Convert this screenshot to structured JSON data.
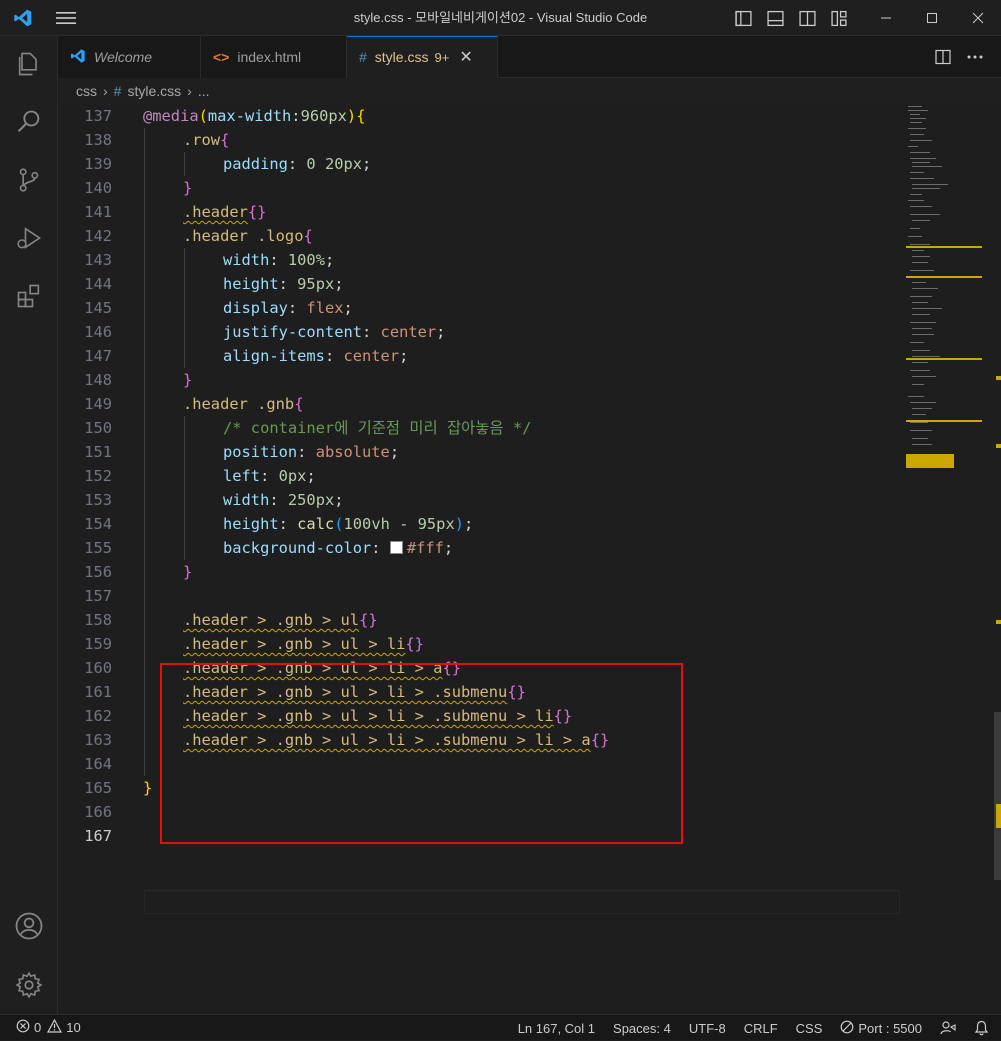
{
  "window": {
    "title": "style.css - 모바일네비게이션02 - Visual Studio Code"
  },
  "icons": {
    "app": "vscode-icon",
    "menu": "hamburger-menu-icon"
  },
  "tabs": [
    {
      "label": "Welcome",
      "icon": "vscode-icon"
    },
    {
      "label": "index.html",
      "icon": "html-icon"
    },
    {
      "label": "style.css",
      "badge": "9+",
      "icon": "hash-icon",
      "active": true
    }
  ],
  "breadcrumb": {
    "folder": "css",
    "file": "style.css",
    "more": "..."
  },
  "editor": {
    "lines": [
      {
        "n": "137"
      },
      {
        "n": "138"
      },
      {
        "n": "139"
      },
      {
        "n": "140"
      },
      {
        "n": "141"
      },
      {
        "n": "142"
      },
      {
        "n": "143"
      },
      {
        "n": "144"
      },
      {
        "n": "145"
      },
      {
        "n": "146"
      },
      {
        "n": "147"
      },
      {
        "n": "148"
      },
      {
        "n": "149"
      },
      {
        "n": "150"
      },
      {
        "n": "151"
      },
      {
        "n": "152"
      },
      {
        "n": "153"
      },
      {
        "n": "154"
      },
      {
        "n": "155"
      },
      {
        "n": "156"
      },
      {
        "n": "157"
      },
      {
        "n": "158"
      },
      {
        "n": "159"
      },
      {
        "n": "160"
      },
      {
        "n": "161"
      },
      {
        "n": "162"
      },
      {
        "n": "163"
      },
      {
        "n": "164"
      },
      {
        "n": "165"
      },
      {
        "n": "166"
      },
      {
        "n": "167"
      }
    ],
    "code": {
      "l137_a": "@media",
      "l137_b": "(",
      "l137_c": "max-width",
      "l137_d": ":",
      "l137_e": "960px",
      "l137_f": ")",
      "l137_g": "{",
      "l138_a": ".row",
      "l138_b": "{",
      "l139_a": "padding",
      "l139_b": ": ",
      "l139_c": "0 20px",
      "l139_d": ";",
      "l140_a": "}",
      "l141_a": ".header",
      "l141_b": "{}",
      "l142_a": ".header .logo",
      "l142_b": "{",
      "l143_a": "width",
      "l143_b": ": ",
      "l143_c": "100%",
      "l143_d": ";",
      "l144_a": "height",
      "l144_b": ": ",
      "l144_c": "95px",
      "l144_d": ";",
      "l145_a": "display",
      "l145_b": ": ",
      "l145_c": "flex",
      "l145_d": ";",
      "l146_a": "justify-content",
      "l146_b": ": ",
      "l146_c": "center",
      "l146_d": ";",
      "l147_a": "align-items",
      "l147_b": ": ",
      "l147_c": "center",
      "l147_d": ";",
      "l148_a": "}",
      "l149_a": ".header .gnb",
      "l149_b": "{",
      "l150_a": "/* container에 기준점 미리 잡아놓음 */",
      "l151_a": "position",
      "l151_b": ": ",
      "l151_c": "absolute",
      "l151_d": ";",
      "l152_a": "left",
      "l152_b": ": ",
      "l152_c": "0px",
      "l152_d": ";",
      "l153_a": "width",
      "l153_b": ": ",
      "l153_c": "250px",
      "l153_d": ";",
      "l154_a": "height",
      "l154_b": ": ",
      "l154_c": "calc",
      "l154_d": "(",
      "l154_e": "100vh - 95px",
      "l154_f": ")",
      "l154_g": ";",
      "l155_a": "background-color",
      "l155_b": ": ",
      "l155_c": "#fff",
      "l155_d": ";",
      "l156_a": "}",
      "l158_a": ".header > .gnb > ul",
      "l158_b": "{}",
      "l159_a": ".header > .gnb > ul > li",
      "l159_b": "{}",
      "l160_a": ".header > .gnb > ul > li > a",
      "l160_b": "{}",
      "l161_a": ".header > .gnb > ul > li > .submenu",
      "l161_b": "{}",
      "l162_a": ".header > .gnb > ul > li > .submenu > li",
      "l162_b": "{}",
      "l163_a": ".header > .gnb > ul > li > .submenu > li > a",
      "l163_b": "{}",
      "l165_a": "}"
    }
  },
  "statusbar": {
    "errors": "0",
    "warnings": "10",
    "position": "Ln 167, Col 1",
    "spaces": "Spaces: 4",
    "encoding": "UTF-8",
    "eol": "CRLF",
    "language": "CSS",
    "port": "Port : 5500"
  },
  "colors": {
    "accent": "#0078d4",
    "highlight_box": "#e01010",
    "warning": "#cca700"
  }
}
